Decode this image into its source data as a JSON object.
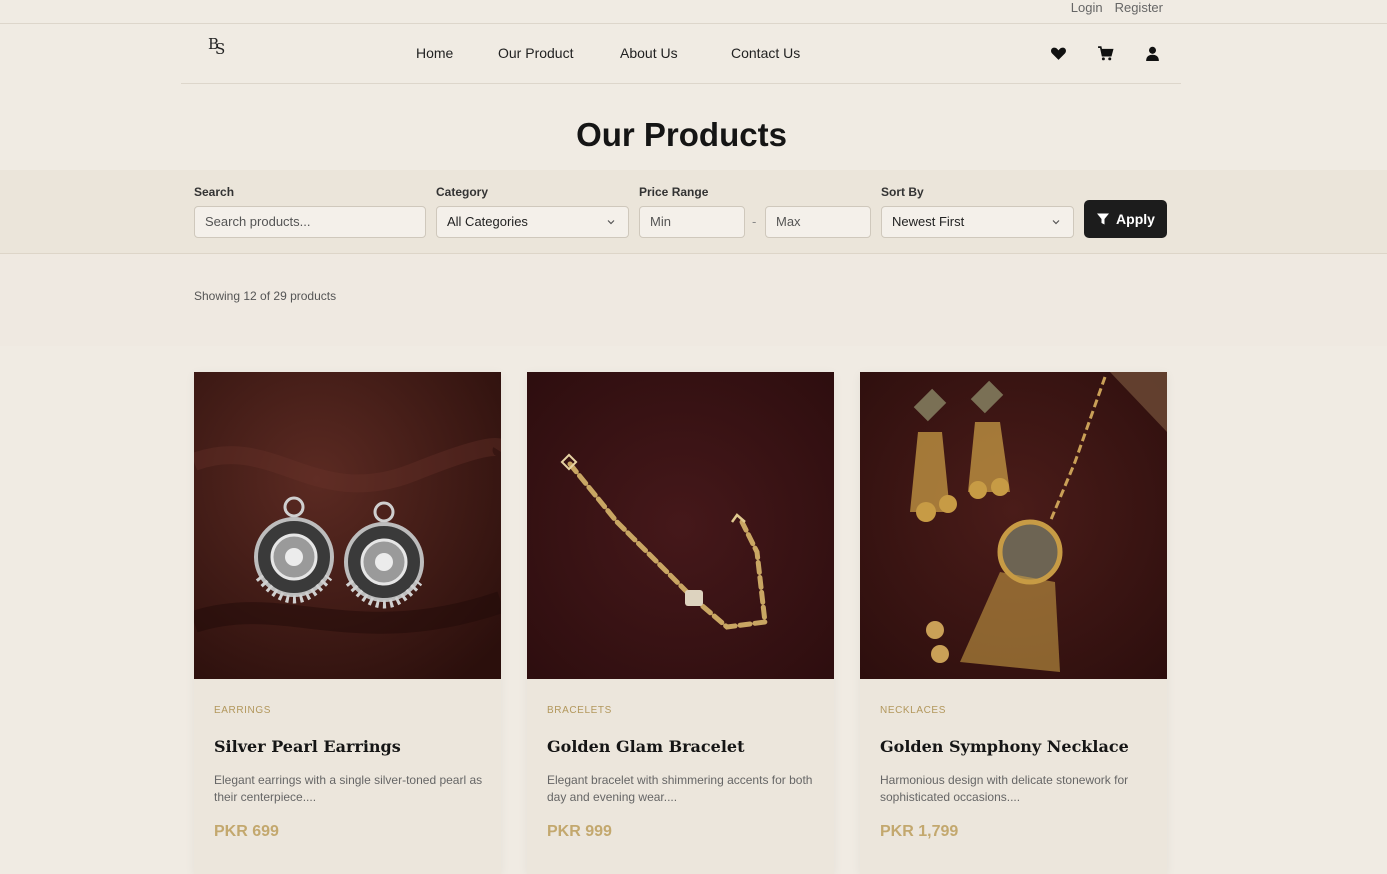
{
  "topbar": {
    "login": "Login",
    "register": "Register"
  },
  "nav": {
    "logo": "BS",
    "links": [
      "Home",
      "Our Product",
      "About Us",
      "Contact Us"
    ],
    "icons": [
      "heart-icon",
      "cart-icon",
      "user-icon"
    ]
  },
  "page": {
    "title": "Our Products"
  },
  "filters": {
    "search_label": "Search",
    "search_placeholder": "Search products...",
    "category_label": "Category",
    "category_value": "All Categories",
    "price_label": "Price Range",
    "min_placeholder": "Min",
    "max_placeholder": "Max",
    "range_separator": "-",
    "sort_label": "Sort By",
    "sort_value": "Newest First",
    "apply_label": "Apply"
  },
  "results": {
    "showing_text": "Showing 12 of 29 products"
  },
  "products": [
    {
      "category": "EARRINGS",
      "name": "Silver Pearl Earrings",
      "description": "Elegant earrings with a single silver-toned pearl as their centerpiece....",
      "price": "PKR 699"
    },
    {
      "category": "BRACELETS",
      "name": "Golden Glam Bracelet",
      "description": "Elegant bracelet with shimmering accents for both day and evening wear....",
      "price": "PKR 999"
    },
    {
      "category": "NECKLACES",
      "name": "Golden Symphony Necklace",
      "description": "Harmonious design with delicate stonework for sophisticated occasions....",
      "price": "PKR 1,799"
    }
  ],
  "colors": {
    "background": "#f0ebe3",
    "accent_gold": "#c3a86e",
    "button_dark": "#1c1c1c",
    "photo_bg": "#3a1512"
  }
}
